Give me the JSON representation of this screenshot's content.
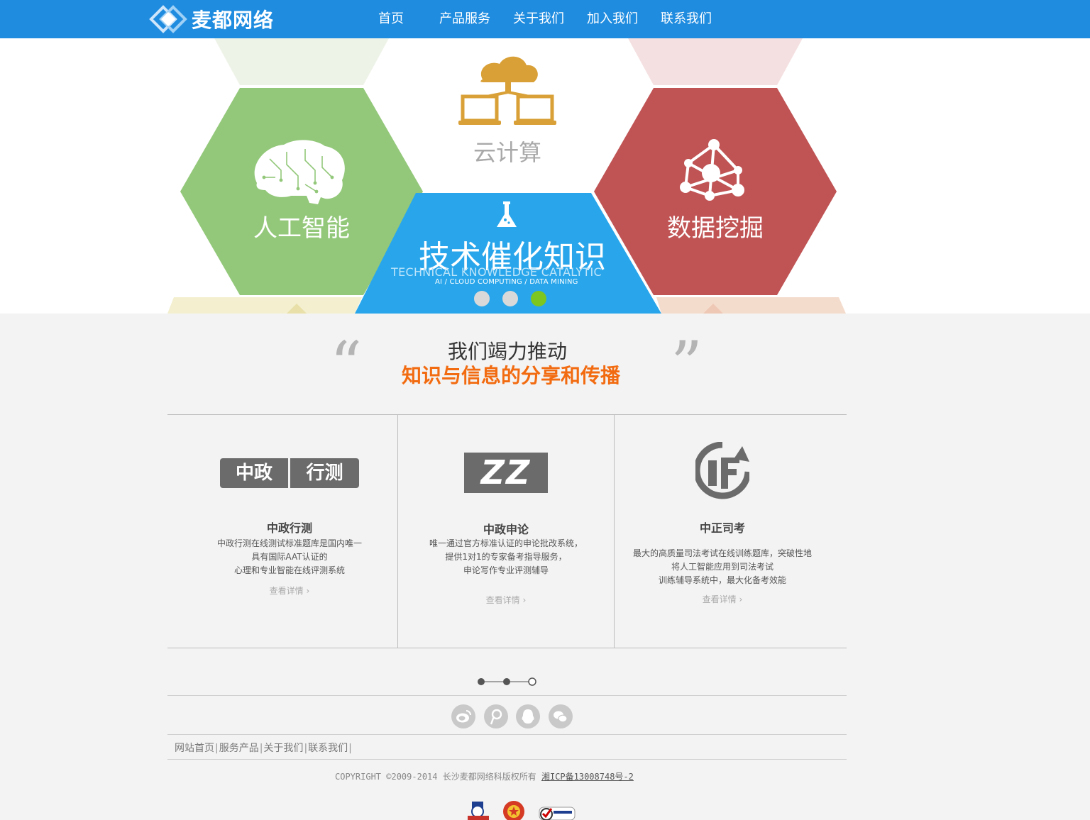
{
  "header": {
    "brand": "麦都网络",
    "nav": [
      "首页",
      "产品服务",
      "关于我们",
      "加入我们",
      "联系我们"
    ]
  },
  "banner": {
    "hex_ai": "人工智能",
    "hex_cloud": "云计算",
    "hex_data": "数据挖掘",
    "center_title": "技术催化知识",
    "center_subtitle": "TECHNICAL KNOWLEDGE CATALYTIC",
    "center_tagline": "AI / CLOUD COMPUTING / DATA MINING",
    "slide_count": 3,
    "active_slide": 3
  },
  "slogan": {
    "line1": "我们竭力推动",
    "line2": "知识与信息的分享和传播"
  },
  "products": [
    {
      "logo_left": "中政",
      "logo_right": "行测",
      "title": "中政行测",
      "desc": [
        "中政行测在线测试标准题库是国内唯一",
        "具有国际AAT认证的",
        "心理和专业智能在线评测系统"
      ],
      "more": "查看详情"
    },
    {
      "logo_text": "ZZ",
      "title": "中政申论",
      "desc": [
        "唯一通过官方标准认证的申论批改系统，",
        "提供1对1的专家备考指导服务，",
        "申论写作专业评测辅导"
      ],
      "more": "查看详情"
    },
    {
      "title": "中正司考",
      "desc": [
        "最大的高质量司法考试在线训练题库，突破性地",
        "将人工智能应用到司法考试",
        "训练辅导系统中，最大化备考效能"
      ],
      "more": "查看详情"
    }
  ],
  "pager": {
    "count": 3,
    "active": 3
  },
  "footer": {
    "links": [
      "网站首页",
      "服务产品",
      "关于我们",
      "联系我们"
    ],
    "copyright": "COPYRIGHT ©2009-2014 长沙麦都网络科版权所有",
    "icp": "湘ICP备13008748号-2"
  },
  "colors": {
    "header": "#1f8ce0",
    "hex_ai": "#93c87a",
    "hex_data": "#c05354",
    "hex_center": "#29a6eb",
    "cloud_icon": "#d9a037",
    "slogan_accent": "#f26b10",
    "dot_active": "#7dc51f"
  }
}
